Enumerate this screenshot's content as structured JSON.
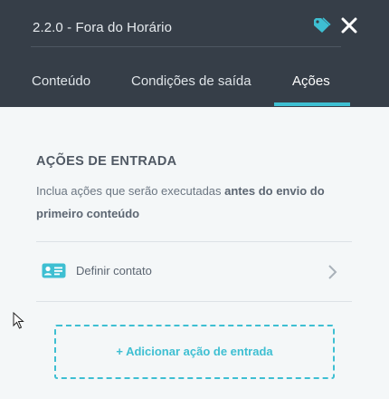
{
  "header": {
    "title": "2.2.0 - Fora do Horário",
    "tag_icon": "tag-icon",
    "close_icon": "close-icon"
  },
  "tabs": [
    {
      "label": "Conteúdo",
      "active": false
    },
    {
      "label": "Condições de saída",
      "active": false
    },
    {
      "label": "Ações",
      "active": true
    }
  ],
  "section": {
    "title": "AÇÕES DE ENTRADA",
    "description_prefix": "Inclua ações que serão executadas ",
    "description_emphasis": "antes do envio do primeiro conteúdo"
  },
  "actions": [
    {
      "label": "Definir contato",
      "icon": "contact-card-icon"
    }
  ],
  "add_button_label": "+ Adicionar ação de entrada",
  "colors": {
    "header_bg": "#363e48",
    "accent": "#3ebfd2",
    "panel_bg": "#f4f7f8"
  }
}
